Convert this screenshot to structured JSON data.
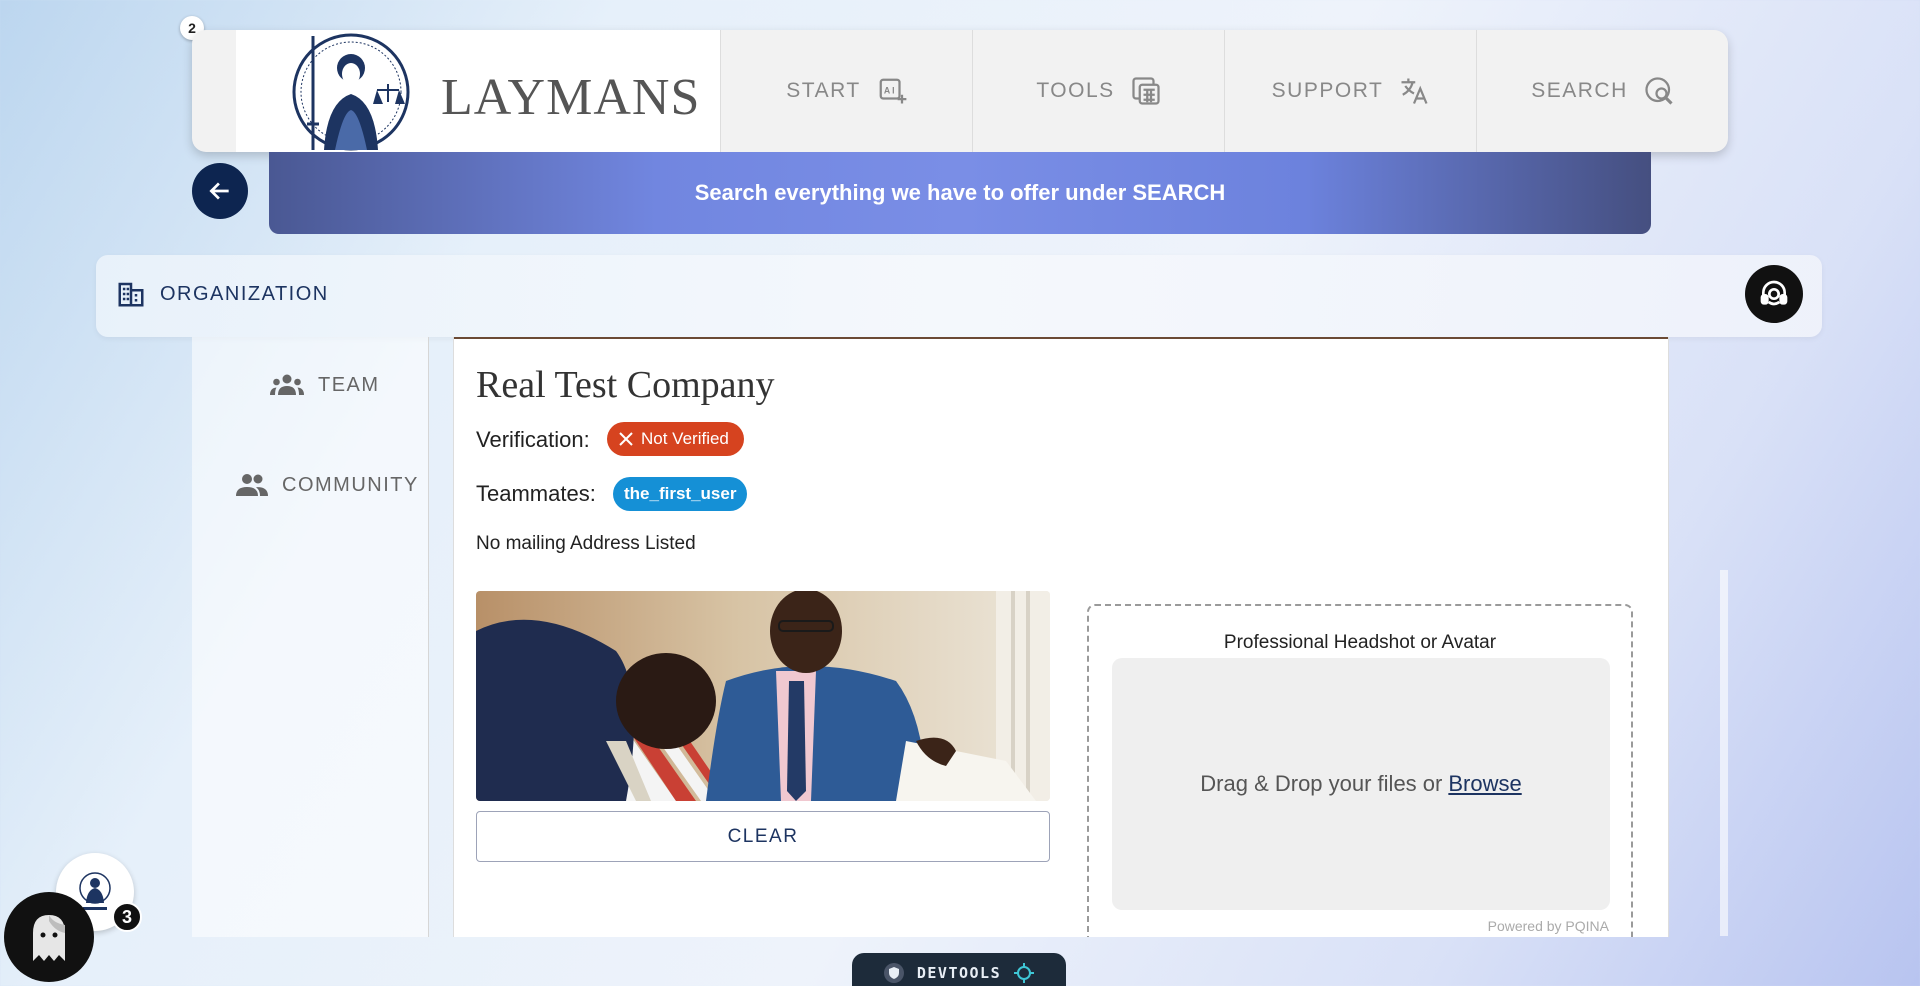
{
  "app": {
    "logo_text": "LAYMANS",
    "notification_count": "2"
  },
  "nav": {
    "items": [
      {
        "label": "START",
        "icon": "ai-sparkle-icon"
      },
      {
        "label": "TOOLS",
        "icon": "calculator-icon"
      },
      {
        "label": "SUPPORT",
        "icon": "translate-icon"
      },
      {
        "label": "SEARCH",
        "icon": "search-globe-icon"
      }
    ]
  },
  "banner": {
    "text": "Search everything we have to offer under SEARCH"
  },
  "org_header": {
    "title": "ORGANIZATION"
  },
  "sidebar": {
    "items": [
      {
        "label": "TEAM",
        "icon": "groups-icon"
      },
      {
        "label": "COMMUNITY",
        "icon": "people-icon"
      }
    ]
  },
  "company": {
    "name": "Real Test Company",
    "verification_label": "Verification:",
    "verification_status": "Not Verified",
    "teammates_label": "Teammates:",
    "teammates": [
      "the_first_user"
    ],
    "address": "No mailing Address Listed"
  },
  "image_panel": {
    "clear_label": "CLEAR"
  },
  "uploader": {
    "title": "Professional Headshot or Avatar",
    "drop_text": "Drag & Drop your files or",
    "browse_label": "Browse",
    "powered_by": "Powered by PQINA"
  },
  "devtools": {
    "label": "DEVTOOLS"
  },
  "assistant": {
    "badge_count": "3"
  },
  "colors": {
    "navy": "#0d2550",
    "not_verified": "#d6431f",
    "teammate_pill": "#1590d6"
  }
}
